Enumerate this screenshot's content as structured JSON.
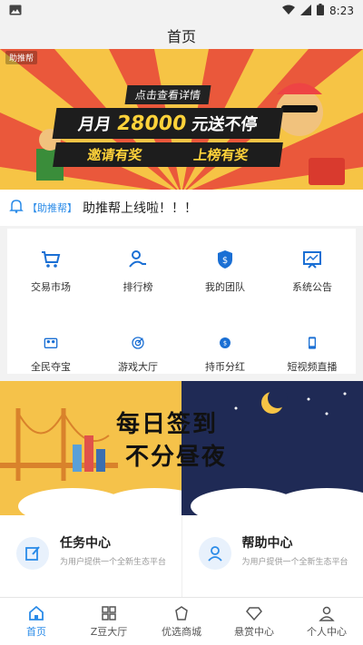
{
  "status_bar": {
    "time": "8:23"
  },
  "header": {
    "title": "首页"
  },
  "banner": {
    "corner_label": "助推帮",
    "subtitle": "点击查看详情",
    "main_prefix": "月月",
    "main_number": "28000",
    "main_suffix": "元送不停",
    "tag_left": "邀请有奖",
    "tag_right": "上榜有奖"
  },
  "notice": {
    "tag": "【助推帮】",
    "message": "助推帮上线啦！！！"
  },
  "grid": {
    "items": [
      {
        "label": "交易市场",
        "icon": "cart-icon"
      },
      {
        "label": "排行榜",
        "icon": "ranking-icon"
      },
      {
        "label": "我的团队",
        "icon": "team-shield-icon"
      },
      {
        "label": "系统公告",
        "icon": "announcement-board-icon"
      },
      {
        "label": "全民夺宝",
        "icon": "people-treasure-icon"
      },
      {
        "label": "游戏大厅",
        "icon": "target-icon"
      },
      {
        "label": "持币分红",
        "icon": "coin-exchange-icon"
      },
      {
        "label": "短视频直播",
        "icon": "phone-video-icon"
      }
    ]
  },
  "checkin": {
    "line1": "每日签到",
    "line2": "不分昼夜"
  },
  "tasks": [
    {
      "title": "任务中心",
      "desc": "为用户提供一个全新生态平台",
      "icon": "task-edit-icon"
    },
    {
      "title": "帮助中心",
      "desc": "为用户提供一个全新生态平台",
      "icon": "help-user-icon"
    }
  ],
  "tabbar": {
    "items": [
      {
        "label": "首页",
        "icon": "home-icon",
        "active": true
      },
      {
        "label": "Z豆大厅",
        "icon": "grid-icon",
        "active": false
      },
      {
        "label": "优选商城",
        "icon": "shop-icon",
        "active": false
      },
      {
        "label": "悬赏中心",
        "icon": "diamond-icon",
        "active": false
      },
      {
        "label": "个人中心",
        "icon": "person-icon",
        "active": false
      }
    ]
  },
  "colors": {
    "accent": "#2a8be8",
    "banner_bg": "#f4b93a",
    "night_bg": "#1f2a55"
  }
}
